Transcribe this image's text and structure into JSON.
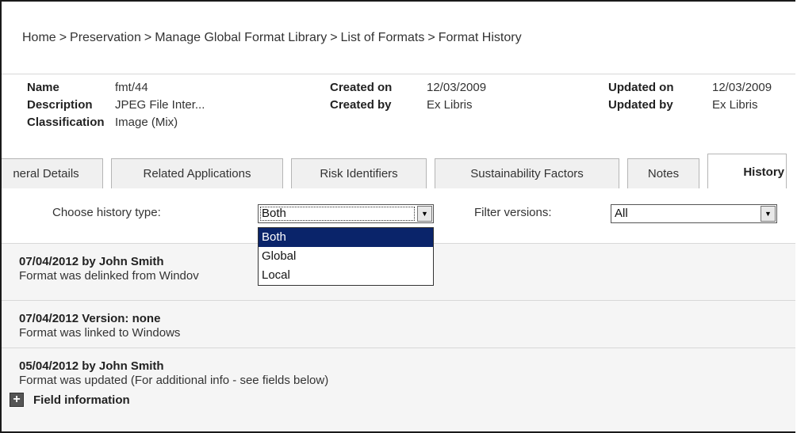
{
  "breadcrumb": {
    "items": [
      "Home",
      "Preservation",
      "Manage Global Format Library",
      "List of Formats",
      "Format History"
    ],
    "separator": ">"
  },
  "info": {
    "name_label": "Name",
    "name_value": "fmt/44",
    "description_label": "Description",
    "description_value": "JPEG File Inter...",
    "classification_label": "Classification",
    "classification_value": "Image (Mix)",
    "created_on_label": "Created on",
    "created_on_value": "12/03/2009",
    "created_by_label": "Created by",
    "created_by_value": "Ex Libris",
    "updated_on_label": "Updated on",
    "updated_on_value": "12/03/2009",
    "updated_by_label": "Updated by",
    "updated_by_value": "Ex Libris"
  },
  "tabs": {
    "general": "neral Details",
    "related": "Related Applications",
    "risk": "Risk Identifiers",
    "sustainability": "Sustainability Factors",
    "notes": "Notes",
    "history": "History"
  },
  "filters": {
    "history_type_label": "Choose history type:",
    "history_type_value": "Both",
    "history_type_options": [
      "Both",
      "Global",
      "Local"
    ],
    "versions_label": "Filter versions:",
    "versions_value": "All"
  },
  "entries": [
    {
      "title": "07/04/2012 by John Smith",
      "desc": "Format was delinked from Windov"
    },
    {
      "title": "07/04/2012 Version: none",
      "desc": "Format was linked to Windows"
    },
    {
      "title": "05/04/2012 by John Smith",
      "desc": "Format was updated (For additional info - see fields below)",
      "field_info": "Field information"
    }
  ],
  "icons": {
    "dropdown_arrow": "triangle-down",
    "expand": "plus"
  },
  "colors": {
    "selected_option_bg": "#0a246a",
    "entry_bg": "#f5f5f5"
  }
}
